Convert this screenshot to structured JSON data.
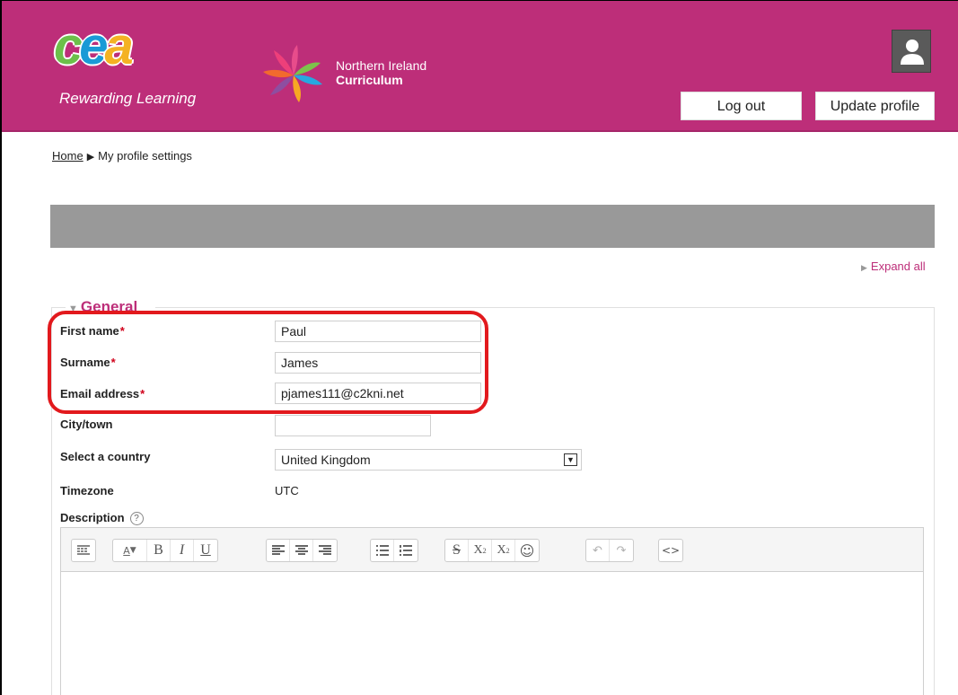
{
  "header": {
    "brand_tagline": "Rewarding Learning",
    "curriculum_line1": "Northern Ireland",
    "curriculum_line2": "Curriculum",
    "logout_label": "Log out",
    "update_profile_label": "Update profile",
    "accent_color": "#bd2e79"
  },
  "breadcrumb": {
    "home": "Home",
    "separator": "▶",
    "current": "My profile settings"
  },
  "expand_all": "Expand all",
  "section": {
    "legend": "General",
    "required_marker": "*",
    "fields": {
      "first_name_label": "First name",
      "first_name_value": "Paul",
      "surname_label": "Surname",
      "surname_value": "James",
      "email_label": "Email address",
      "email_value": "pjames111@c2kni.net",
      "city_label": "City/town",
      "city_value": "",
      "country_label": "Select a country",
      "country_value": "United Kingdom",
      "timezone_label": "Timezone",
      "timezone_value": "UTC",
      "description_label": "Description",
      "help_icon": "?"
    }
  },
  "editor_toolbar": {
    "groups": [
      [
        "show-more-icon"
      ],
      [
        "font-style-icon",
        "bold-icon",
        "italic-icon",
        "underline-icon"
      ],
      [
        "align-left-icon",
        "align-center-icon",
        "align-right-icon"
      ],
      [
        "unordered-list-icon",
        "ordered-list-icon"
      ],
      [
        "strikethrough-icon",
        "subscript-icon",
        "superscript-icon",
        "emoji-icon"
      ],
      [
        "undo-icon",
        "redo-icon"
      ],
      [
        "html-icon"
      ]
    ]
  }
}
